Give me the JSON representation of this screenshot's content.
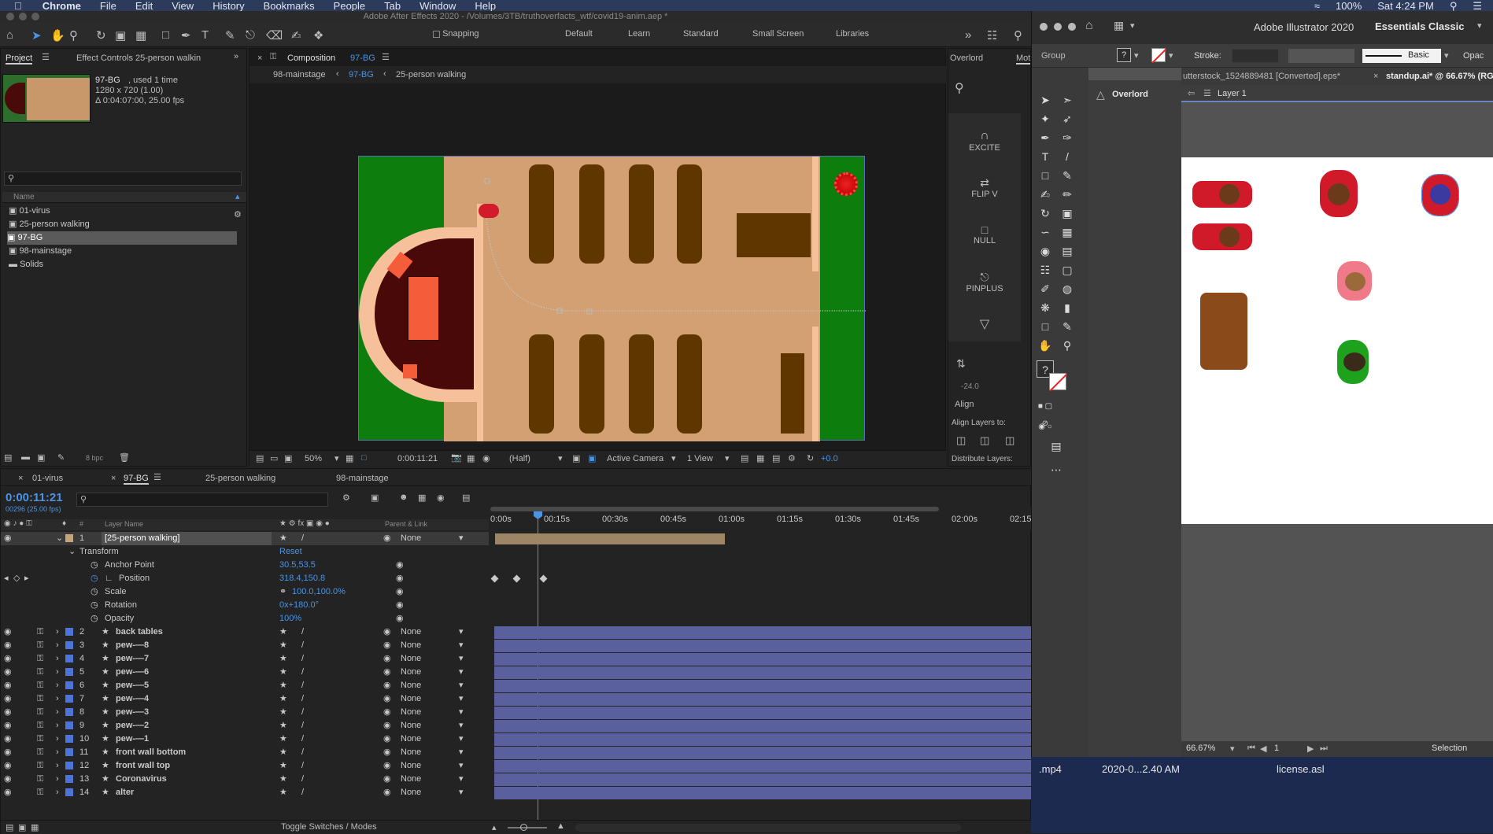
{
  "menubar": {
    "app": "Chrome",
    "items": [
      "File",
      "Edit",
      "View",
      "History",
      "Bookmarks",
      "People",
      "Tab",
      "Window",
      "Help"
    ],
    "battery": "100%",
    "clock": "Sat 4:24 PM"
  },
  "ae": {
    "title": "Adobe After Effects 2020 - /Volumes/3TB/truthoverfacts_wtf/covid19-anim.aep *",
    "toolbar": {
      "snapping_label": "Snapping",
      "workspaces": [
        "Default",
        "Learn",
        "Standard",
        "Small Screen",
        "Libraries"
      ]
    },
    "project": {
      "tab_label": "Project",
      "effect_controls_label": "Effect Controls 25-person walkin",
      "item_name": "97-BG",
      "item_usage": ", used 1 time",
      "item_size": "1280 x 720 (1.00)",
      "item_duration": "Δ 0:04:07:00, 25.00 fps",
      "search_placeholder": "",
      "column_name": "Name",
      "items": [
        {
          "name": "01-virus",
          "type": "comp"
        },
        {
          "name": "25-person walking",
          "type": "comp"
        },
        {
          "name": "97-BG",
          "type": "comp"
        },
        {
          "name": "98-mainstage",
          "type": "comp"
        },
        {
          "name": "Solids",
          "type": "folder"
        }
      ],
      "bpc": "8 bpc"
    },
    "composition": {
      "tab_label": "Composition",
      "tab_comp": "97-BG",
      "breadcrumbs": [
        "98-mainstage",
        "97-BG",
        "25-person walking"
      ],
      "zoom": "50%",
      "timecode": "0:00:11:21",
      "resolution": "(Half)",
      "camera": "Active Camera",
      "view": "1 View",
      "exposure": "+0.0"
    },
    "side_panel": {
      "tabs": [
        "Overlord",
        "Mot"
      ],
      "buttons": [
        "EXCITE",
        "FLIP V",
        "NULL",
        "PINPLUS"
      ],
      "align_title": "Align",
      "align_to_label": "Align Layers to:",
      "distribute_label": "Distribute Layers:",
      "value": "-24.0"
    },
    "timeline": {
      "tabs": [
        "01-virus",
        "97-BG",
        "25-person walking",
        "98-mainstage"
      ],
      "current_time": "0:00:11:21",
      "frame_info": "00296 (25.00 fps)",
      "col_layer_name": "Layer Name",
      "col_parent": "Parent & Link",
      "ruler": [
        "0:00s",
        "00:15s",
        "00:30s",
        "00:45s",
        "01:00s",
        "01:15s",
        "01:30s",
        "01:45s",
        "02:00s",
        "02:15"
      ],
      "selected_layer": {
        "num": "1",
        "name": "[25-person walking]",
        "parent": "None"
      },
      "transform_label": "Transform",
      "reset_label": "Reset",
      "properties": [
        {
          "name": "Anchor Point",
          "value": "30.5,53.5"
        },
        {
          "name": "Position",
          "value": "318.4,150.8"
        },
        {
          "name": "Scale",
          "value": "100.0,100.0%"
        },
        {
          "name": "Rotation",
          "value": "0x+180.0°"
        },
        {
          "name": "Opacity",
          "value": "100%"
        }
      ],
      "layers": [
        {
          "num": "2",
          "name": "back tables",
          "parent": "None"
        },
        {
          "num": "3",
          "name": "pew-—8",
          "parent": "None"
        },
        {
          "num": "4",
          "name": "pew-—7",
          "parent": "None"
        },
        {
          "num": "5",
          "name": "pew-—6",
          "parent": "None"
        },
        {
          "num": "6",
          "name": "pew-—5",
          "parent": "None"
        },
        {
          "num": "7",
          "name": "pew-—4",
          "parent": "None"
        },
        {
          "num": "8",
          "name": "pew-—3",
          "parent": "None"
        },
        {
          "num": "9",
          "name": "pew-—2",
          "parent": "None"
        },
        {
          "num": "10",
          "name": "pew-—1",
          "parent": "None"
        },
        {
          "num": "11",
          "name": "front wall bottom",
          "parent": "None"
        },
        {
          "num": "12",
          "name": "front wall top",
          "parent": "None"
        },
        {
          "num": "13",
          "name": "Coronavirus",
          "parent": "None"
        },
        {
          "num": "14",
          "name": "alter",
          "parent": "None"
        }
      ],
      "footer": "Toggle Switches / Modes"
    }
  },
  "ai": {
    "title": "Adobe Illustrator 2020",
    "workspace": "Essentials Classic",
    "control": {
      "selection_type": "Group",
      "stroke_label": "Stroke:",
      "brush": "Basic",
      "opacity_label": "Opac"
    },
    "doc_tabs": [
      "utterstock_1524889481 [Converted].eps*",
      "standup.ai* @ 66.67% (RGB/G"
    ],
    "layer_name": "Layer 1",
    "overlord_label": "Overlord",
    "zoom": "66.67%",
    "artboard": "1",
    "status": "Selection"
  },
  "desktop": {
    "files": [
      ".mp4",
      "2020-0...2.40 AM",
      "license.asl"
    ]
  },
  "colors": {
    "accent": "#4b94e3",
    "track": "#5a5f9e",
    "menubar": "#2c3a5c"
  }
}
